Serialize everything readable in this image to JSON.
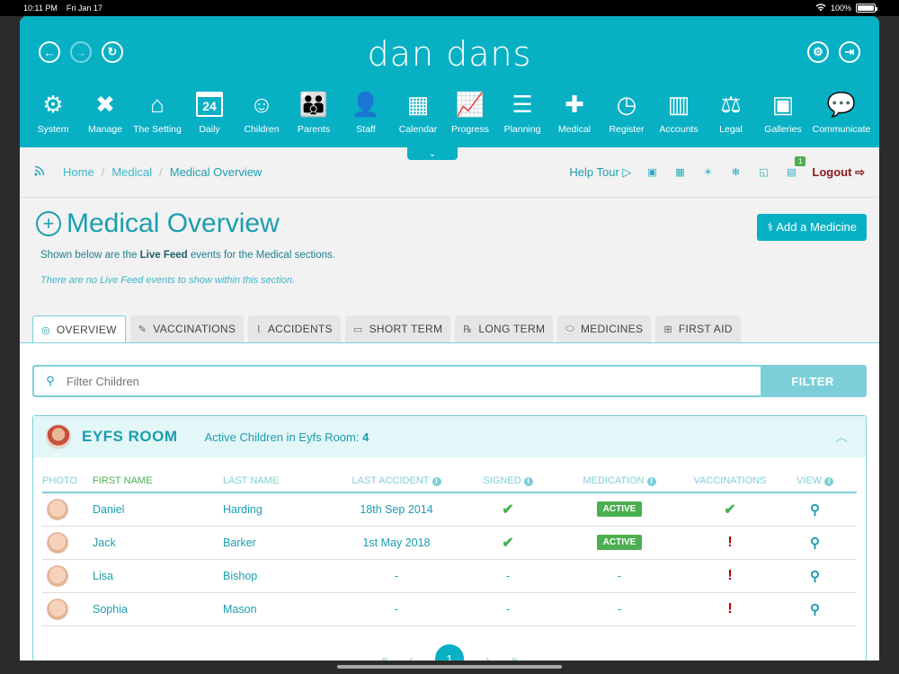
{
  "status": {
    "time": "10:11 PM",
    "date": "Fri Jan 17",
    "battery": "100%",
    "battery_level": 1.0
  },
  "header": {
    "brand": "dan dans",
    "nav": [
      {
        "label": "System",
        "icon": "gear-icon"
      },
      {
        "label": "Manage",
        "icon": "tools-icon"
      },
      {
        "label": "The Setting",
        "icon": "building-icon"
      },
      {
        "label": "Daily",
        "icon": "calendar-day-icon",
        "glyph": "24"
      },
      {
        "label": "Children",
        "icon": "child-face-icon"
      },
      {
        "label": "Parents",
        "icon": "parents-icon"
      },
      {
        "label": "Staff",
        "icon": "staff-icon"
      },
      {
        "label": "Calendar",
        "icon": "calendar-icon"
      },
      {
        "label": "Progress",
        "icon": "progress-chart-icon"
      },
      {
        "label": "Planning",
        "icon": "checklist-icon"
      },
      {
        "label": "Medical",
        "icon": "medical-cross-icon"
      },
      {
        "label": "Register",
        "icon": "clock-icon"
      },
      {
        "label": "Accounts",
        "icon": "binders-icon"
      },
      {
        "label": "Legal",
        "icon": "scales-icon"
      },
      {
        "label": "Galleries",
        "icon": "gallery-icon"
      },
      {
        "label": "Communicate",
        "icon": "chat-icon"
      }
    ]
  },
  "breadcrumb": {
    "home": "Home",
    "section": "Medical",
    "current": "Medical Overview"
  },
  "toolbar": {
    "help_tour": "Help Tour",
    "logout": "Logout",
    "notification_count": "1"
  },
  "page": {
    "title": "Medical Overview",
    "add_button": "Add a Medicine",
    "desc_prefix": "Shown below are the ",
    "desc_bold": "Live Feed",
    "desc_suffix": " events for the Medical sections.",
    "no_feed": "There are no Live Feed events to show within this section."
  },
  "tabs": [
    {
      "label": "Overview",
      "icon": "overview-icon"
    },
    {
      "label": "Vaccinations",
      "icon": "syringe-icon"
    },
    {
      "label": "Accidents",
      "icon": "bandage-icon"
    },
    {
      "label": "Short Term",
      "icon": "pill-bottle-icon"
    },
    {
      "label": "Long Term",
      "icon": "prescription-icon"
    },
    {
      "label": "Medicines",
      "icon": "pills-icon"
    },
    {
      "label": "First Aid",
      "icon": "first-aid-kit-icon"
    }
  ],
  "filter": {
    "placeholder": "Filter Children",
    "button": "FILTER"
  },
  "room": {
    "name": "EYFS ROOM",
    "count_label": "Active Children in Eyfs Room:",
    "count": "4",
    "columns": [
      "PHOTO",
      "FIRST NAME",
      "LAST NAME",
      "LAST ACCIDENT",
      "SIGNED",
      "MEDICATION",
      "VACCINATIONS",
      "VIEW"
    ],
    "rows": [
      {
        "first": "Daniel",
        "last": "Harding",
        "accident": "18th Sep 2014",
        "signed": "✔",
        "medication": "ACTIVE",
        "vacc": "✔"
      },
      {
        "first": "Jack",
        "last": "Barker",
        "accident": "1st May 2018",
        "signed": "✔",
        "medication": "ACTIVE",
        "vacc": "!"
      },
      {
        "first": "Lisa",
        "last": "Bishop",
        "accident": "-",
        "signed": "-",
        "medication": "-",
        "vacc": "!"
      },
      {
        "first": "Sophia",
        "last": "Mason",
        "accident": "-",
        "signed": "-",
        "medication": "-",
        "vacc": "!"
      }
    ]
  },
  "pagination": {
    "first": "«",
    "prev": "‹",
    "page": "1",
    "next": "›",
    "last": "»"
  },
  "colors": {
    "primary": "#08b0c4",
    "active_green": "#4caf50",
    "warning_red": "#b30000"
  }
}
